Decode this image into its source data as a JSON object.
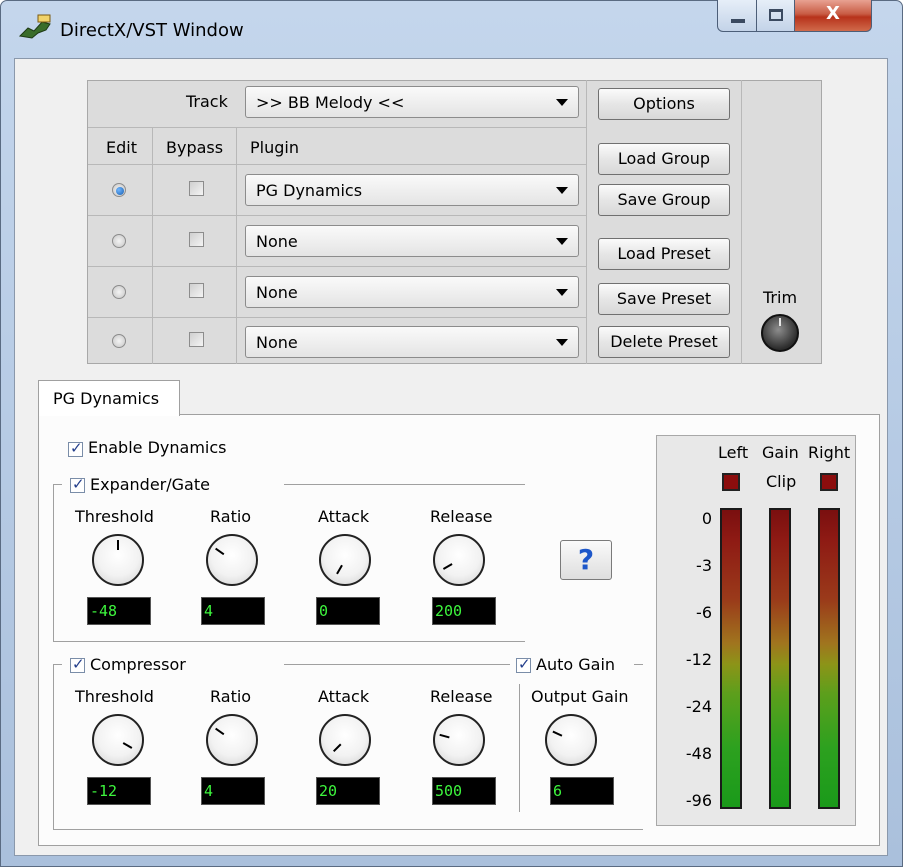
{
  "window": {
    "title": "DirectX/VST Window",
    "close_glyph": "X"
  },
  "panel": {
    "track_label": "Track",
    "track_value": ">> BB Melody <<",
    "headers": {
      "edit": "Edit",
      "bypass": "Bypass",
      "plugin": "Plugin"
    },
    "rows": [
      {
        "edit": true,
        "bypass": false,
        "plugin": "PG Dynamics"
      },
      {
        "edit": false,
        "bypass": false,
        "plugin": "None"
      },
      {
        "edit": false,
        "bypass": false,
        "plugin": "None"
      },
      {
        "edit": false,
        "bypass": false,
        "plugin": "None"
      }
    ],
    "buttons": {
      "options": "Options",
      "load_group": "Load Group",
      "save_group": "Save Group",
      "load_preset": "Load Preset",
      "save_preset": "Save Preset",
      "delete_preset": "Delete Preset"
    },
    "trim_label": "Trim"
  },
  "tab": {
    "label": "PG Dynamics"
  },
  "dynamics": {
    "enable_label": "Enable Dynamics",
    "enable_checked": true,
    "expander": {
      "label": "Expander/Gate",
      "checked": true,
      "knobs": [
        {
          "label": "Threshold",
          "value": "-48"
        },
        {
          "label": "Ratio",
          "value": "4"
        },
        {
          "label": "Attack",
          "value": "0"
        },
        {
          "label": "Release",
          "value": "200"
        }
      ]
    },
    "compressor": {
      "label": "Compressor",
      "checked": true,
      "knobs": [
        {
          "label": "Threshold",
          "value": "-12"
        },
        {
          "label": "Ratio",
          "value": "4"
        },
        {
          "label": "Attack",
          "value": "20"
        },
        {
          "label": "Release",
          "value": "500"
        }
      ]
    },
    "auto_gain": {
      "label": "Auto Gain",
      "checked": true
    },
    "output_gain": {
      "label": "Output Gain",
      "value": "6"
    },
    "help_glyph": "?"
  },
  "meters": {
    "left_label": "Left",
    "gain_label": "Gain",
    "right_label": "Right",
    "clip_label": "Clip",
    "scale": [
      "0",
      "-3",
      "-6",
      "-12",
      "-24",
      "-48",
      "-96"
    ]
  },
  "colors": {
    "lcd_text": "#3df53d",
    "clip_led": "#8b0d0d",
    "help_question": "#1d57c9"
  }
}
